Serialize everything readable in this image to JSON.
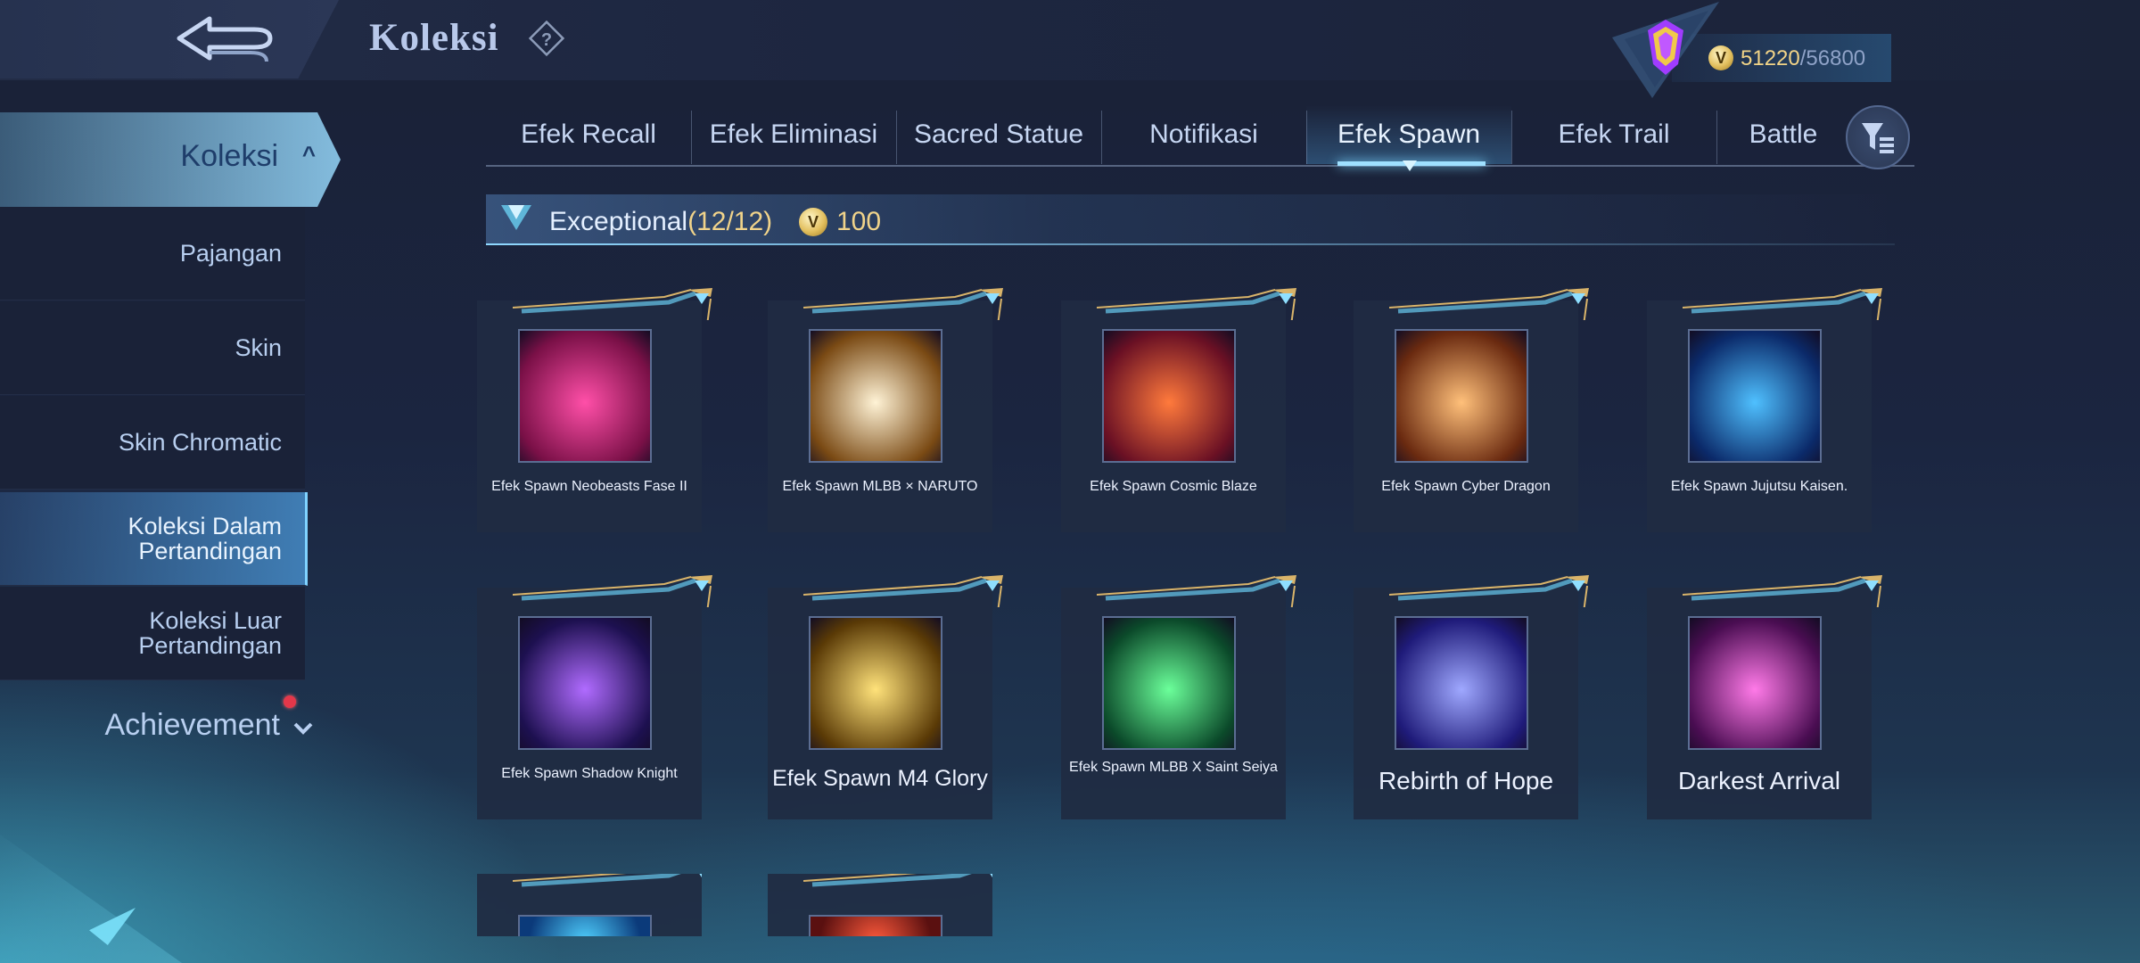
{
  "header": {
    "title": "Koleksi",
    "currency_current": "51220",
    "currency_sep_total": "/56800"
  },
  "sidebar": {
    "active_group": "Koleksi",
    "items": [
      {
        "label": "Pajangan"
      },
      {
        "label": "Skin"
      },
      {
        "label": "Skin Chromatic"
      },
      {
        "label": "Koleksi Dalam Pertandingan",
        "line1": "Koleksi Dalam",
        "line2": "Pertandingan",
        "selected": true
      },
      {
        "label": "Koleksi Luar Pertandingan",
        "line1": "Koleksi Luar",
        "line2": "Pertandingan"
      }
    ],
    "achievement": "Achievement"
  },
  "tabs": [
    {
      "label": "Efek Recall"
    },
    {
      "label": "Efek Eliminasi"
    },
    {
      "label": "Sacred Statue"
    },
    {
      "label": "Notifikasi"
    },
    {
      "label": "Efek Spawn",
      "active": true
    },
    {
      "label": "Efek Trail"
    },
    {
      "label": "Battle"
    }
  ],
  "section": {
    "title": "Exceptional",
    "count": "(12/12)",
    "price": "100"
  },
  "items": [
    {
      "name": "Efek Spawn Neobeasts Fase II",
      "colors": [
        "#ff4fa8",
        "#7a1047"
      ]
    },
    {
      "name": "Efek Spawn MLBB × NARUTO",
      "colors": [
        "#fff3d6",
        "#7a4a14"
      ]
    },
    {
      "name": "Efek Spawn Cosmic Blaze",
      "colors": [
        "#ff7a3c",
        "#6a1024"
      ]
    },
    {
      "name": "Efek Spawn Cyber Dragon",
      "colors": [
        "#ffc07a",
        "#6a2a10"
      ]
    },
    {
      "name": "Efek Spawn Jujutsu Kaisen.",
      "colors": [
        "#4fc0ff",
        "#0b2a6a"
      ]
    },
    {
      "name": "Efek Spawn Shadow Knight",
      "colors": [
        "#b06bff",
        "#1d1050"
      ]
    },
    {
      "name": "Efek Spawn M4 Glory",
      "colors": [
        "#ffe27a",
        "#5a3a06"
      ]
    },
    {
      "name": "Efek Spawn MLBB X Saint Seiya",
      "colors": [
        "#6bff9a",
        "#0b4a2a"
      ]
    },
    {
      "name": "Rebirth of Hope",
      "colors": [
        "#9fa8ff",
        "#1f1b7a"
      ]
    },
    {
      "name": "Darkest Arrival",
      "colors": [
        "#ff7ae8",
        "#4a0d52"
      ]
    }
  ],
  "partial_items": [
    {
      "colors": [
        "#4fd0ff",
        "#0b3a7a"
      ]
    },
    {
      "colors": [
        "#ff5a3c",
        "#5a1010"
      ]
    }
  ]
}
